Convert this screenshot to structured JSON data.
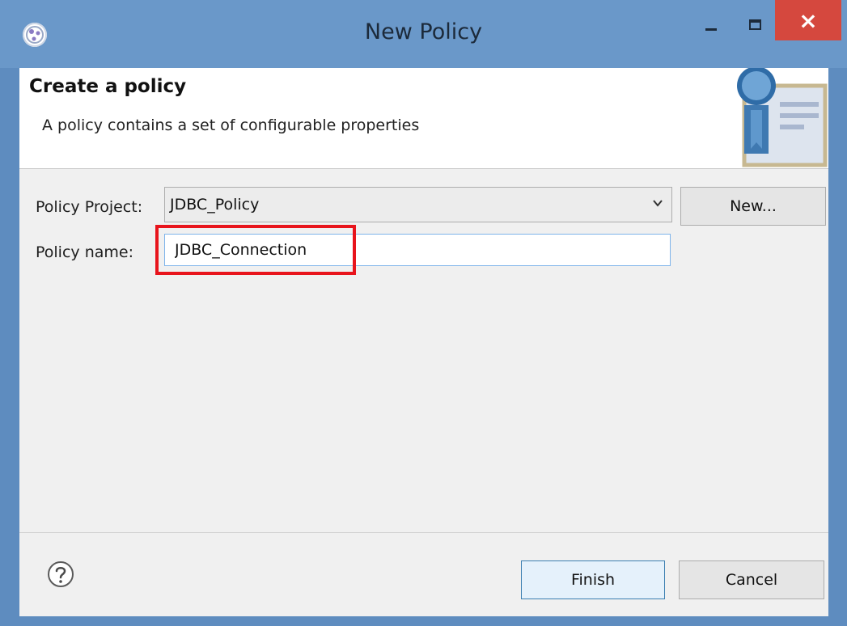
{
  "window": {
    "title": "New Policy",
    "controls": {
      "minimize": "minimize-icon",
      "maximize": "maximize-icon",
      "close": "×"
    },
    "accent": "#6a98c9",
    "close_color": "#d5483e"
  },
  "header": {
    "title": "Create a policy",
    "description": "A policy contains a set of configurable properties",
    "banner_icon": "policy-certificate-icon"
  },
  "form": {
    "project_label": "Policy Project:",
    "project_value": "JDBC_Policy",
    "new_button": "New...",
    "name_label": "Policy name:",
    "name_value": "JDBC_Connection",
    "highlight_color": "#e8141c"
  },
  "footer": {
    "help_icon": "help-icon",
    "finish_button": "Finish",
    "cancel_button": "Cancel"
  }
}
